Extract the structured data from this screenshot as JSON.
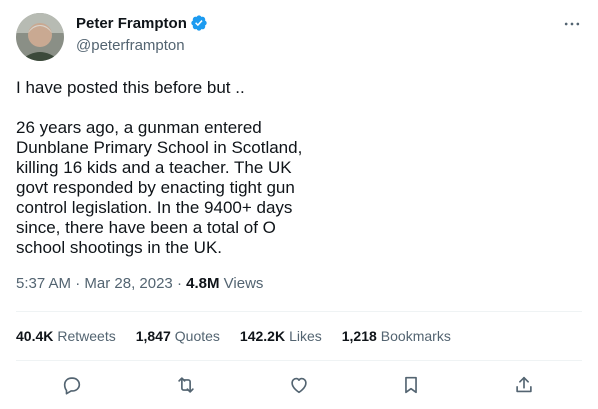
{
  "author": {
    "name": "Peter Frampton",
    "handle": "@peterframpton"
  },
  "tweet": {
    "text": "I have posted this before but ..\n\n26 years ago, a gunman entered Dunblane Primary School in Scotland, killing 16 kids and a teacher. The UK govt responded by enacting tight gun control legislation. In the 9400+ days since, there have been a total of O school shootings in the UK.",
    "time": "5:37 AM",
    "date": "Mar 28, 2023",
    "views_count": "4.8M",
    "views_label": "Views"
  },
  "stats": [
    {
      "count": "40.4K",
      "label": "Retweets"
    },
    {
      "count": "1,847",
      "label": "Quotes"
    },
    {
      "count": "142.2K",
      "label": "Likes"
    },
    {
      "count": "1,218",
      "label": "Bookmarks"
    }
  ],
  "icons": {
    "verified": "verified-badge-icon",
    "more": "more-icon",
    "reply": "reply-icon",
    "retweet": "retweet-icon",
    "like": "heart-icon",
    "bookmark": "bookmark-icon",
    "share": "share-icon"
  },
  "colors": {
    "verified": "#1d9bf0",
    "text": "#0f1419",
    "secondary": "#536471",
    "divider": "#eff3f4"
  }
}
